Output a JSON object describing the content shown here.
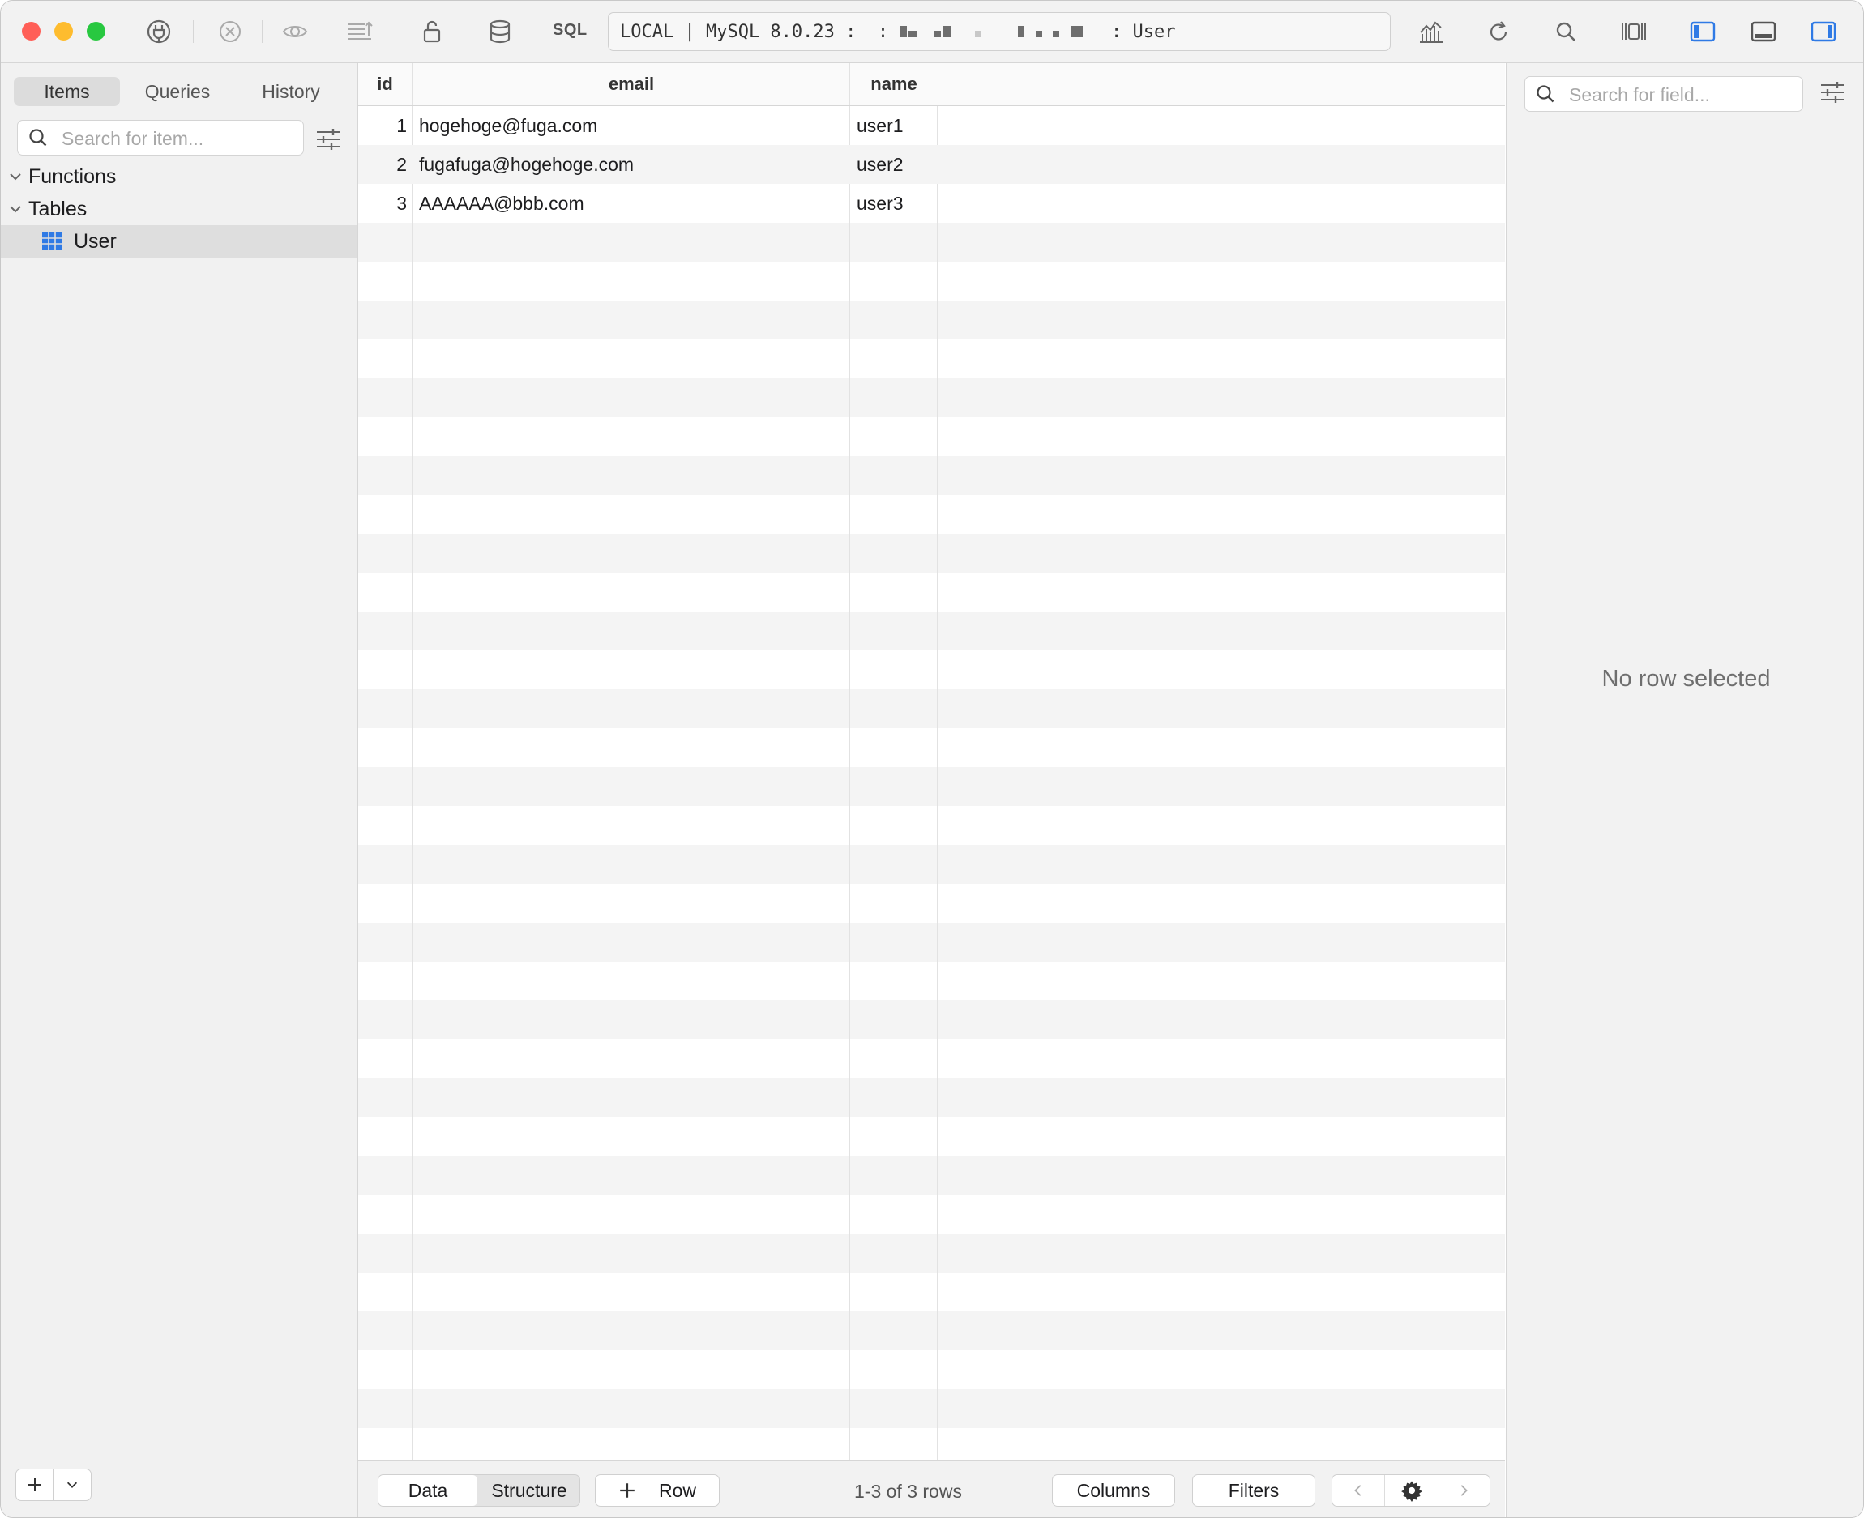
{
  "toolbar": {
    "sql_label": "SQL",
    "connection_prefix": "LOCAL | MySQL 8.0.23 :  :",
    "connection_suffix": ": User",
    "icons": [
      "connection-icon",
      "close-circle-icon",
      "preview-icon",
      "export-icon",
      "lock-icon",
      "database-icon",
      "sql-icon",
      "chart-icon",
      "refresh-icon",
      "search-icon",
      "column-layout-icon",
      "toggle-left-panel-icon",
      "toggle-bottom-panel-icon",
      "toggle-right-panel-icon"
    ],
    "colors": {
      "close": "#ff5f57",
      "minimize": "#febc2e",
      "zoom": "#28c840",
      "accent": "#2f7ae5"
    }
  },
  "sidebar": {
    "tabs": [
      {
        "label": "Items",
        "active": true
      },
      {
        "label": "Queries",
        "active": false
      },
      {
        "label": "History",
        "active": false
      }
    ],
    "search_placeholder": "Search for item...",
    "tree": [
      {
        "label": "Functions",
        "expanded": true
      },
      {
        "label": "Tables",
        "expanded": true,
        "children": [
          {
            "label": "User",
            "selected": true
          }
        ]
      }
    ]
  },
  "grid": {
    "columns": [
      "id",
      "email",
      "name"
    ],
    "rows": [
      {
        "id": "1",
        "email": "hogehoge@fuga.com",
        "name": "user1"
      },
      {
        "id": "2",
        "email": "fugafuga@hogehoge.com",
        "name": "user2"
      },
      {
        "id": "3",
        "email": "AAAAAA@bbb.com",
        "name": "user3"
      }
    ]
  },
  "bottombar": {
    "view_tabs": [
      {
        "label": "Data",
        "active": true
      },
      {
        "label": "Structure",
        "active": false
      }
    ],
    "add_row_label": "Row",
    "row_count": "1-3 of 3 rows",
    "columns_label": "Columns",
    "filters_label": "Filters"
  },
  "right_panel": {
    "search_placeholder": "Search for field...",
    "empty_message": "No row selected"
  }
}
